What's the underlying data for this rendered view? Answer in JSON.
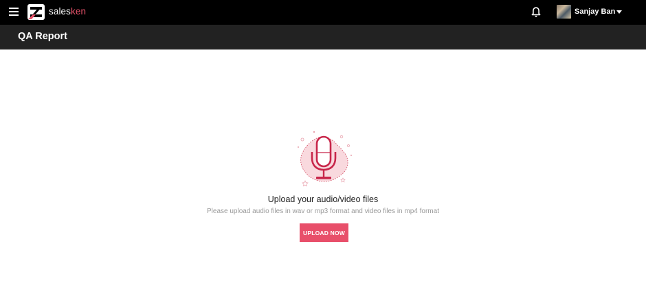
{
  "brand": {
    "name_part1": "sales",
    "name_part2": "ken",
    "accent_color": "#e8536b"
  },
  "topbar": {
    "menu_icon": "hamburger-menu-icon",
    "notification_icon": "bell-icon",
    "user": {
      "name": "Sanjay Ban",
      "dropdown_icon": "caret-down-icon"
    }
  },
  "header": {
    "title": "QA Report"
  },
  "empty_state": {
    "illustration_icon": "microphone-icon",
    "title": "Upload your audio/video files",
    "description": "Please upload audio files in wav or mp3 format and video files in mp4 format",
    "button_label": "UPLOAD NOW",
    "button_color": "#e84f6a"
  }
}
